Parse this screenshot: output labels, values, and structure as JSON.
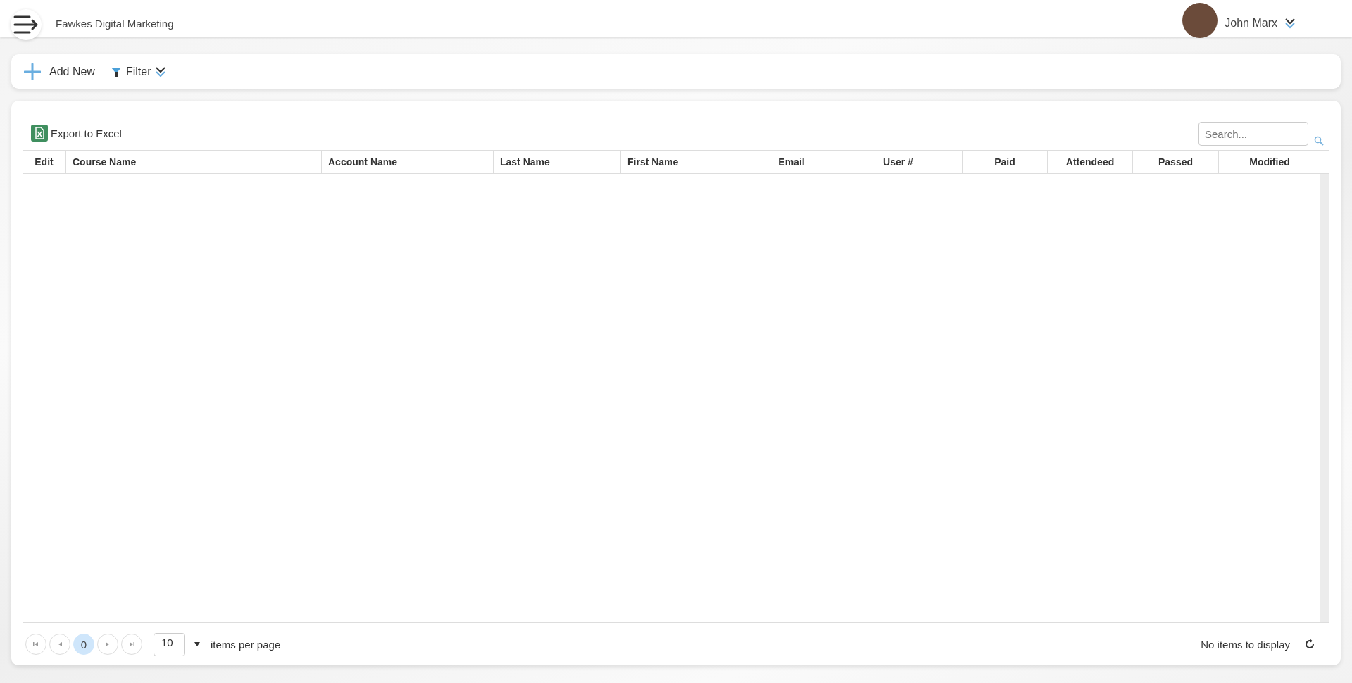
{
  "header": {
    "company": "Fawkes Digital Marketing",
    "user": "John Marx"
  },
  "toolbar": {
    "add_label": "Add New",
    "filter_label": "Filter"
  },
  "grid": {
    "export_label": "Export to Excel",
    "search": {
      "placeholder": "Search..."
    },
    "columns": [
      {
        "label": "Edit",
        "kind": "action"
      },
      {
        "label": "Course Name",
        "kind": "name"
      },
      {
        "label": "Account Name",
        "kind": "name"
      },
      {
        "label": "Last Name",
        "kind": "name"
      },
      {
        "label": "First Name",
        "kind": "name"
      },
      {
        "label": "Email",
        "kind": "data"
      },
      {
        "label": "User #",
        "kind": "data"
      },
      {
        "label": "Paid",
        "kind": "data"
      },
      {
        "label": "Attendeed",
        "kind": "data"
      },
      {
        "label": "Passed",
        "kind": "data"
      },
      {
        "label": "Modified",
        "kind": "data"
      }
    ]
  },
  "pager": {
    "pages": [
      {
        "label": "0",
        "selected": true
      }
    ],
    "page_size": "10",
    "per_page_label": "items per page",
    "status": "No items to display"
  }
}
